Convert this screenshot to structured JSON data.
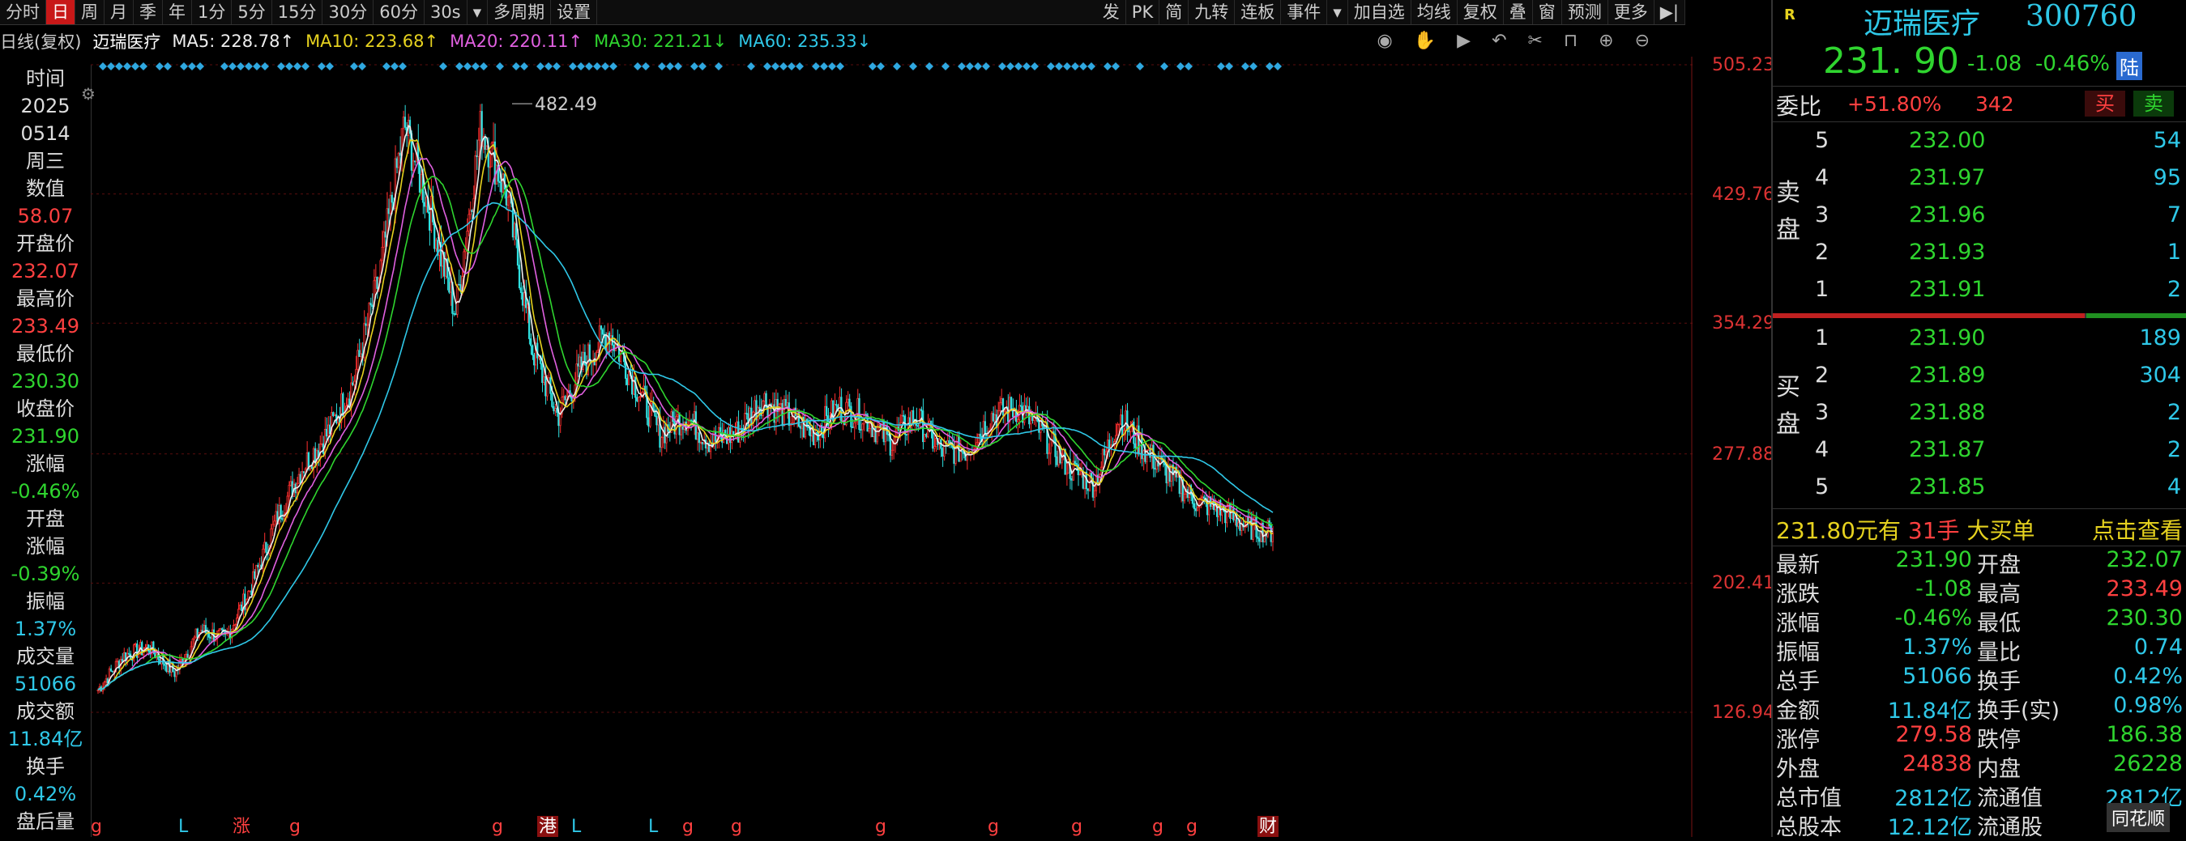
{
  "toolbar": {
    "items": [
      "分时",
      "日",
      "周",
      "月",
      "季",
      "年",
      "1分",
      "5分",
      "15分",
      "30分",
      "60分",
      "30s",
      "▾",
      "多周期",
      "设置"
    ],
    "active_index": 1,
    "right_items": [
      "发",
      "PK",
      "简",
      "九转",
      "连板",
      "事件",
      "▾",
      "加自选",
      "均线",
      "复权",
      "叠",
      "窗",
      "预测",
      "更多"
    ]
  },
  "mabar": {
    "period": "日线(复权)",
    "name": "迈瑞医疗",
    "ma5": "MA5: 228.78↑",
    "ma10": "MA10: 223.68↑",
    "ma20": "MA20: 220.11↑",
    "ma30": "MA30: 221.21↓",
    "ma60": "MA60: 235.33↓"
  },
  "left": {
    "rows": [
      {
        "text": "时间",
        "color": "#dddddd"
      },
      {
        "text": "2025",
        "color": "#dddddd"
      },
      {
        "text": "0514",
        "color": "#dddddd"
      },
      {
        "text": "周三",
        "color": "#dddddd"
      },
      {
        "text": "数值",
        "color": "#dddddd"
      },
      {
        "text": "58.07",
        "color": "#ff4040"
      },
      {
        "text": "开盘价",
        "color": "#dddddd"
      },
      {
        "text": "232.07",
        "color": "#ff4040"
      },
      {
        "text": "最高价",
        "color": "#dddddd"
      },
      {
        "text": "233.49",
        "color": "#ff4040"
      },
      {
        "text": "最低价",
        "color": "#dddddd"
      },
      {
        "text": "230.30",
        "color": "#2fd52f"
      },
      {
        "text": "收盘价",
        "color": "#dddddd"
      },
      {
        "text": "231.90",
        "color": "#2fd52f"
      },
      {
        "text": "涨幅",
        "color": "#dddddd"
      },
      {
        "text": "-0.46%",
        "color": "#2fd52f"
      },
      {
        "text": "开盘",
        "color": "#dddddd"
      },
      {
        "text": "涨幅",
        "color": "#dddddd"
      },
      {
        "text": "-0.39%",
        "color": "#2fd52f"
      },
      {
        "text": "振幅",
        "color": "#dddddd"
      },
      {
        "text": "1.37%",
        "color": "#2fc8e8"
      },
      {
        "text": "成交量",
        "color": "#dddddd"
      },
      {
        "text": "51066",
        "color": "#2fc8e8"
      },
      {
        "text": "成交额",
        "color": "#dddddd"
      },
      {
        "text": "11.84亿",
        "color": "#2fc8e8"
      },
      {
        "text": "换手",
        "color": "#dddddd"
      },
      {
        "text": "0.42%",
        "color": "#2fc8e8"
      },
      {
        "text": "盘后量",
        "color": "#dddddd"
      }
    ]
  },
  "axis": {
    "labels": [
      "505.23",
      "429.76",
      "354.29",
      "277.88",
      "202.41",
      "126.94"
    ],
    "values": [
      505.23,
      429.76,
      354.29,
      277.88,
      202.41,
      126.94
    ],
    "peak_label": "482.49"
  },
  "markers": [
    "g",
    "L",
    "涨",
    "g",
    "g",
    "港",
    "L",
    "L",
    "g",
    "g",
    "g",
    "g",
    "g",
    "g",
    "g",
    "财"
  ],
  "chart_data": {
    "type": "line",
    "ylim": [
      126.94,
      505.23
    ],
    "anchor_closes": [
      140,
      160,
      165,
      150,
      175,
      170,
      200,
      240,
      270,
      290,
      320,
      380,
      470,
      420,
      360,
      470,
      430,
      340,
      300,
      330,
      350,
      320,
      290,
      300,
      285,
      290,
      310,
      300,
      290,
      305,
      300,
      285,
      300,
      280,
      280,
      300,
      305,
      290,
      270,
      260,
      300,
      280,
      265,
      250,
      245,
      235,
      232
    ],
    "peak": 482.49,
    "last_close": 231.9
  },
  "right": {
    "logo": "R",
    "name": "迈瑞医疗",
    "code": "300760",
    "price": "231. 90",
    "change": "-1.08",
    "pct": "-0.46%",
    "market": "陆",
    "weibi_label": "委比",
    "weibi_value": "+51.80%",
    "weibi_diff": "342",
    "sell_btn": "买",
    "buy_btn": "卖",
    "sell_label": [
      "卖",
      "盘"
    ],
    "buy_label": [
      "买",
      "盘"
    ],
    "sells": [
      {
        "lvl": "5",
        "price": "232.00",
        "vol": "54"
      },
      {
        "lvl": "4",
        "price": "231.97",
        "vol": "95"
      },
      {
        "lvl": "3",
        "price": "231.96",
        "vol": "7"
      },
      {
        "lvl": "2",
        "price": "231.93",
        "vol": "1"
      },
      {
        "lvl": "1",
        "price": "231.91",
        "vol": "2"
      }
    ],
    "buys": [
      {
        "lvl": "1",
        "price": "231.90",
        "vol": "189"
      },
      {
        "lvl": "2",
        "price": "231.89",
        "vol": "304"
      },
      {
        "lvl": "3",
        "price": "231.88",
        "vol": "2"
      },
      {
        "lvl": "4",
        "price": "231.87",
        "vol": "2"
      },
      {
        "lvl": "5",
        "price": "231.85",
        "vol": "4"
      }
    ],
    "big_order": {
      "price": "231.80元有",
      "lots": "31手",
      "label": "大买单",
      "link": "点击查看"
    },
    "stats": [
      {
        "k1": "最新",
        "v1": "231.90",
        "c1": "#2fd52f",
        "k2": "开盘",
        "v2": "232.07",
        "c2": "#2fd52f"
      },
      {
        "k1": "涨跌",
        "v1": "-1.08",
        "c1": "#2fd52f",
        "k2": "最高",
        "v2": "233.49",
        "c2": "#ff4040"
      },
      {
        "k1": "涨幅",
        "v1": "-0.46%",
        "c1": "#2fd52f",
        "k2": "最低",
        "v2": "230.30",
        "c2": "#2fd52f"
      },
      {
        "k1": "振幅",
        "v1": "1.37%",
        "c1": "#2fc8e8",
        "k2": "量比",
        "v2": "0.74",
        "c2": "#2fc8e8"
      },
      {
        "k1": "总手",
        "v1": "51066",
        "c1": "#2fc8e8",
        "k2": "换手",
        "v2": "0.42%",
        "c2": "#2fc8e8"
      },
      {
        "k1": "金额",
        "v1": "11.84亿",
        "c1": "#2fc8e8",
        "k2": "换手(实)",
        "v2": "0.98%",
        "c2": "#2fc8e8"
      },
      {
        "k1": "涨停",
        "v1": "279.58",
        "c1": "#ff4040",
        "k2": "跌停",
        "v2": "186.38",
        "c2": "#2fd52f"
      },
      {
        "k1": "外盘",
        "v1": "24838",
        "c1": "#ff4040",
        "k2": "内盘",
        "v2": "26228",
        "c2": "#2fd52f"
      },
      {
        "k1": "总市值",
        "v1": "2812亿",
        "c1": "#2fc8e8",
        "k2": "流通值",
        "v2": "2812亿",
        "c2": "#2fc8e8"
      },
      {
        "k1": "总股本",
        "v1": "12.12亿",
        "c1": "#2fc8e8",
        "k2": "流通股",
        "v2": "",
        "c2": "#2fc8e8"
      }
    ],
    "watermark": "同花顺"
  }
}
